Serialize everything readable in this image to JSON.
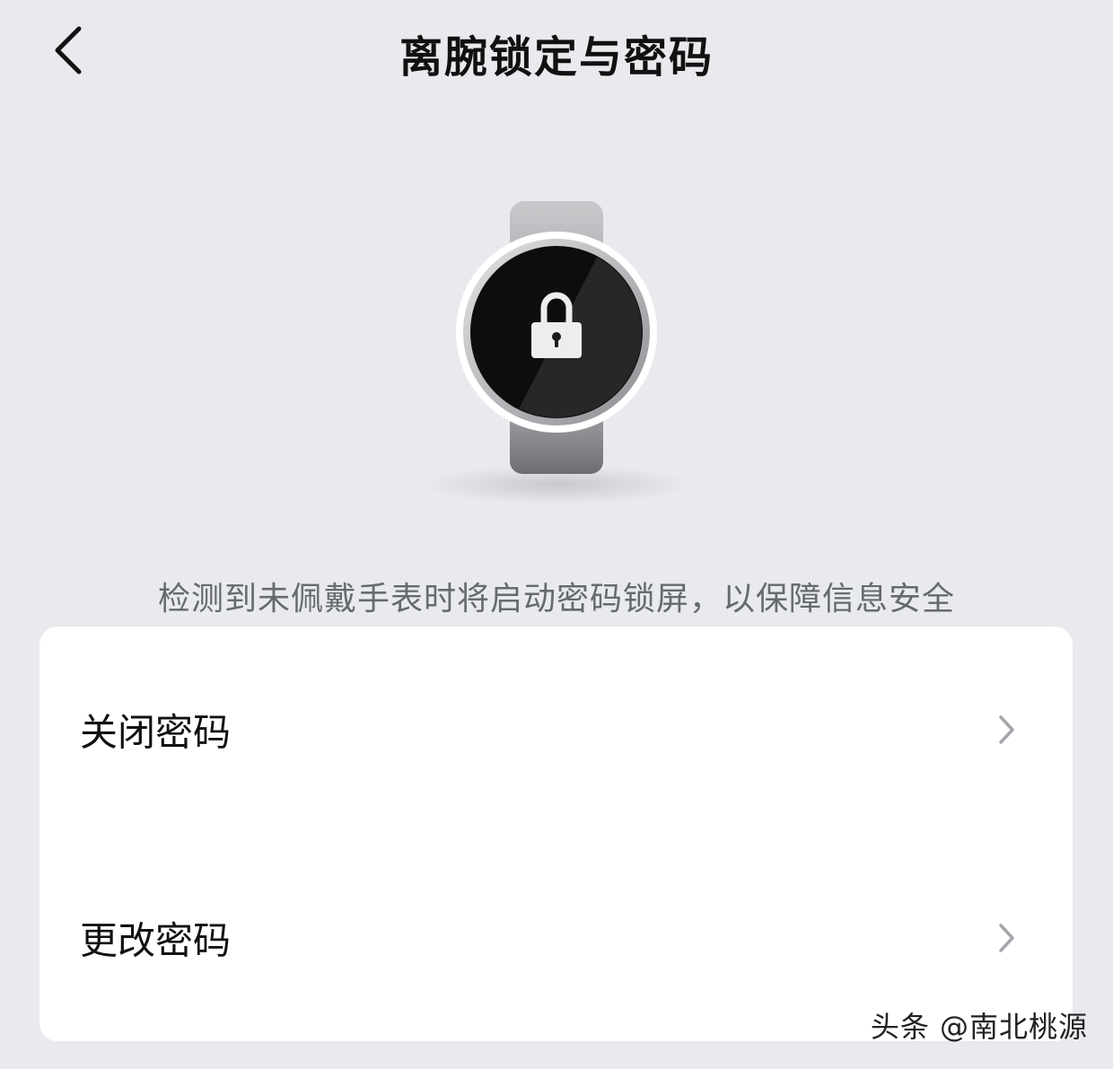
{
  "header": {
    "title": "离腕锁定与密码",
    "back_icon": "chevron-left-icon"
  },
  "illustration": {
    "icon": "watch-lock-icon"
  },
  "description": "检测到未佩戴手表时将启动密码锁屏，以保障信息安全",
  "settings": {
    "items": [
      {
        "label": "关闭密码",
        "icon": "chevron-right-icon"
      },
      {
        "label": "更改密码",
        "icon": "chevron-right-icon"
      }
    ]
  },
  "watermark": "头条 @南北桃源",
  "colors": {
    "background": "#e9eaee",
    "card": "#ffffff",
    "description": "#666a70"
  }
}
